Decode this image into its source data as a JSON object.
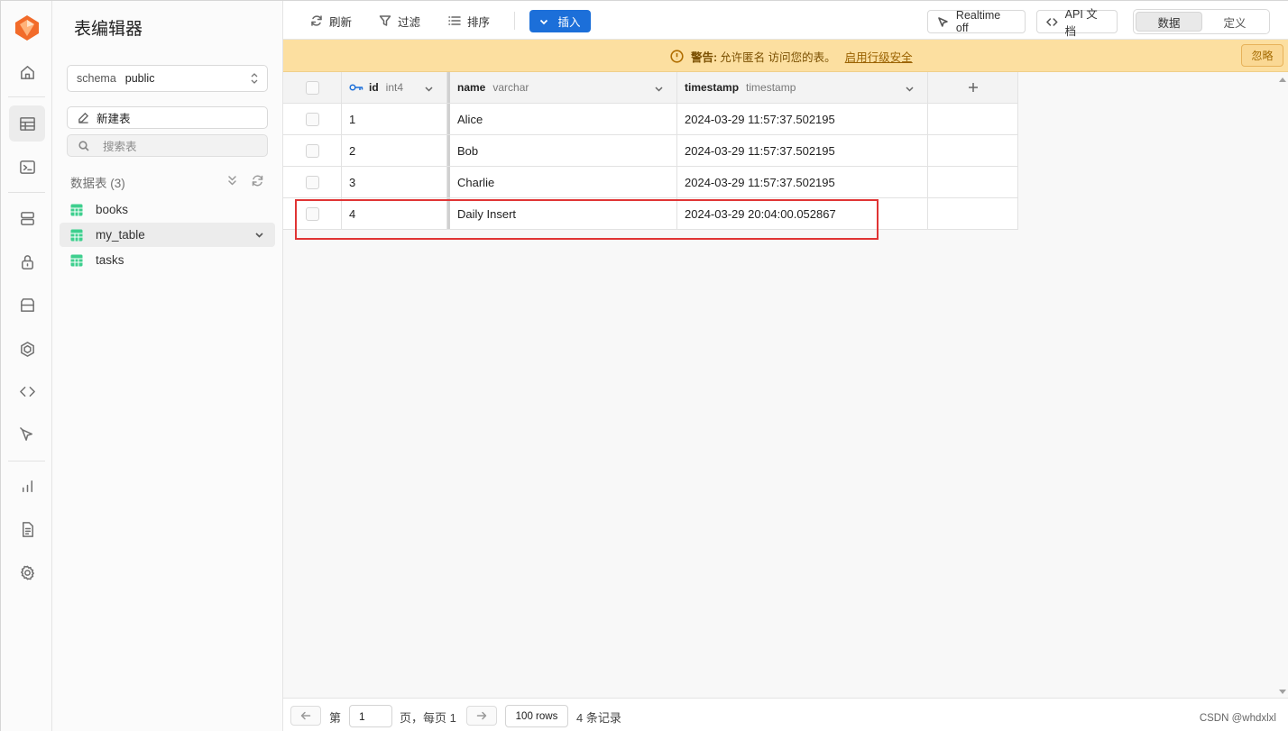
{
  "app": {
    "title": "表编辑器"
  },
  "sidebar": {
    "schema_label": "schema",
    "schema_value": "public",
    "new_table": "新建表",
    "search_placeholder": "搜索表",
    "tables_header": "数据表 (3)",
    "tables": [
      {
        "name": "books"
      },
      {
        "name": "my_table"
      },
      {
        "name": "tasks"
      }
    ]
  },
  "toolbar": {
    "refresh": "刷新",
    "filter": "过滤",
    "sort": "排序",
    "insert": "插入",
    "realtime": "Realtime off",
    "api_docs": "API 文档",
    "view_data": "数据",
    "view_definition": "定义"
  },
  "warning": {
    "title": "警告:",
    "text": "允许匿名 访问您的表。",
    "link": "启用行级安全",
    "dismiss": "忽略"
  },
  "grid": {
    "columns": [
      {
        "name": "id",
        "type": "int4"
      },
      {
        "name": "name",
        "type": "varchar"
      },
      {
        "name": "timestamp",
        "type": "timestamp"
      }
    ],
    "rows": [
      {
        "id": "1",
        "name": "Alice",
        "timestamp": "2024-03-29 11:57:37.502195"
      },
      {
        "id": "2",
        "name": "Bob",
        "timestamp": "2024-03-29 11:57:37.502195"
      },
      {
        "id": "3",
        "name": "Charlie",
        "timestamp": "2024-03-29 11:57:37.502195"
      },
      {
        "id": "4",
        "name": "Daily Insert",
        "timestamp": "2024-03-29 20:04:00.052867"
      }
    ]
  },
  "footer": {
    "page_prefix": "第",
    "page_value": "1",
    "page_suffix": "页，每页 1",
    "rows_per_page": "100 rows",
    "record_count": "4 条记录",
    "watermark": "CSDN @whdxlxl"
  },
  "colors": {
    "accent": "#1c6fd9",
    "warning_bg": "#fcdfa0",
    "highlight": "#e03434",
    "brand": "#f26b2a"
  }
}
